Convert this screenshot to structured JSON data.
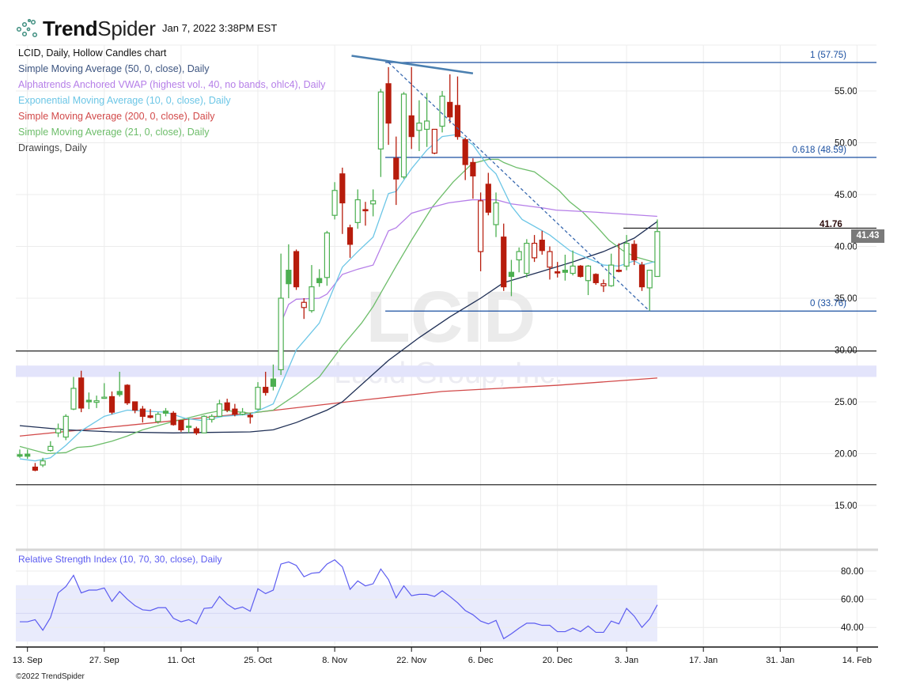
{
  "header": {
    "logo_text_bold": "Trend",
    "logo_text_light": "Spider",
    "timestamp": "Jan 7, 2022 3:38PM EST"
  },
  "legend": [
    {
      "label": "LCID, Daily, Hollow Candles chart",
      "color": "#111111"
    },
    {
      "label": "Simple Moving Average (50, 0, close), Daily",
      "color": "#3d5580"
    },
    {
      "label": "Alphatrends Anchored VWAP (highest vol., 40, no bands, ohlc4), Daily",
      "color": "#b57ee8"
    },
    {
      "label": "Exponential Moving Average (10, 0, close), Daily",
      "color": "#6cc6e6"
    },
    {
      "label": "Simple Moving Average (200, 0, close), Daily",
      "color": "#d24a4a"
    },
    {
      "label": "Simple Moving Average (21, 0, close), Daily",
      "color": "#6dbd6a"
    },
    {
      "label": "Drawings, Daily",
      "color": "#444444"
    }
  ],
  "watermark": {
    "symbol": "LCID",
    "company": "Lucid Group, Inc."
  },
  "footer": "©2022 TrendSpider",
  "chart_data": {
    "type": "candlestick",
    "symbol": "LCID",
    "interval": "Daily",
    "style": "Hollow Candles",
    "colors": {
      "up": "#4caf50",
      "down": "#b71c0c",
      "sma50": "#1f2f55",
      "vwap": "#b57ee8",
      "ema10": "#6cc6e6",
      "sma200": "#d24a4a",
      "sma21": "#6dbd6a",
      "rsi": "#5c5cf0"
    },
    "price_axis": {
      "range": [
        13,
        60
      ],
      "ticks": [
        "55.00",
        "50.00",
        "45.00",
        "40.00",
        "35.00",
        "30.00",
        "25.00",
        "20.00",
        "15.00"
      ],
      "tick_values": [
        55,
        50,
        45,
        40,
        35,
        30,
        25,
        20,
        15
      ]
    },
    "x_ticks": [
      {
        "label": "13. Sep",
        "index": 1
      },
      {
        "label": "27. Sep",
        "index": 11
      },
      {
        "label": "11. Oct",
        "index": 21
      },
      {
        "label": "25. Oct",
        "index": 31
      },
      {
        "label": "8. Nov",
        "index": 41
      },
      {
        "label": "22. Nov",
        "index": 51
      },
      {
        "label": "6. Dec",
        "index": 60
      },
      {
        "label": "20. Dec",
        "index": 70
      },
      {
        "label": "3. Jan",
        "index": 79
      },
      {
        "label": "17. Jan",
        "index": 89
      },
      {
        "label": "31. Jan",
        "index": 99
      },
      {
        "label": "14. Feb",
        "index": 109
      }
    ],
    "candles": [
      [
        19.9,
        20.4,
        19.6,
        19.75,
        "g"
      ],
      [
        19.95,
        20.4,
        19.5,
        19.75,
        "g"
      ],
      [
        18.7,
        19.1,
        18.3,
        18.4,
        "r"
      ],
      [
        18.9,
        19.6,
        18.7,
        19.3,
        "g"
      ],
      [
        20.3,
        21.2,
        20.2,
        20.7,
        "g"
      ],
      [
        22.0,
        22.9,
        21.6,
        22.4,
        "g"
      ],
      [
        21.6,
        23.8,
        21.3,
        23.6,
        "g"
      ],
      [
        24.3,
        27.4,
        24.2,
        26.3,
        "g"
      ],
      [
        27.3,
        28.0,
        24.0,
        24.4,
        "r"
      ],
      [
        25.15,
        25.9,
        24.3,
        25.0,
        "g"
      ],
      [
        24.95,
        25.6,
        24.4,
        25.1,
        "g"
      ],
      [
        25.4,
        26.8,
        25.3,
        25.45,
        "g"
      ],
      [
        25.5,
        26.0,
        23.8,
        24.0,
        "r"
      ],
      [
        26.0,
        27.9,
        25.5,
        25.7,
        "g"
      ],
      [
        26.6,
        26.7,
        24.7,
        24.9,
        "r"
      ],
      [
        25.0,
        25.0,
        23.9,
        24.2,
        "r"
      ],
      [
        24.3,
        24.6,
        23.0,
        23.6,
        "r"
      ],
      [
        23.65,
        24.3,
        23.4,
        23.5,
        "r"
      ],
      [
        23.1,
        24.0,
        22.9,
        23.8,
        "g"
      ],
      [
        24.1,
        24.4,
        23.6,
        23.9,
        "g"
      ],
      [
        23.9,
        24.1,
        22.7,
        22.8,
        "r"
      ],
      [
        23.2,
        23.2,
        22.1,
        22.3,
        "r"
      ],
      [
        22.65,
        23.4,
        22.0,
        22.55,
        "g"
      ],
      [
        22.4,
        22.6,
        21.8,
        22.0,
        "r"
      ],
      [
        22.0,
        23.7,
        22.0,
        23.6,
        "g"
      ],
      [
        23.3,
        23.8,
        23.0,
        23.6,
        "g"
      ],
      [
        23.6,
        25.2,
        23.6,
        24.8,
        "g"
      ],
      [
        24.9,
        25.3,
        24.0,
        24.2,
        "r"
      ],
      [
        24.3,
        24.8,
        23.6,
        23.8,
        "r"
      ],
      [
        23.8,
        24.4,
        23.7,
        24.0,
        "g"
      ],
      [
        23.7,
        23.9,
        22.9,
        23.55,
        "r"
      ],
      [
        24.3,
        26.9,
        24.2,
        26.4,
        "g"
      ],
      [
        26.4,
        27.9,
        25.6,
        25.9,
        "r"
      ],
      [
        27.2,
        28.6,
        26.1,
        26.5,
        "g"
      ],
      [
        28.1,
        39.3,
        27.6,
        35.0,
        "g"
      ],
      [
        37.7,
        40.2,
        35.0,
        36.4,
        "g"
      ],
      [
        39.5,
        39.7,
        35.8,
        36.1,
        "r"
      ],
      [
        34.1,
        35.0,
        33.0,
        34.6,
        "r"
      ],
      [
        33.8,
        38.2,
        33.6,
        36.1,
        "g"
      ],
      [
        36.9,
        37.8,
        36.1,
        36.5,
        "g"
      ],
      [
        37.0,
        41.5,
        36.2,
        41.3,
        "g"
      ],
      [
        43.0,
        46.2,
        42.6,
        45.4,
        "g"
      ],
      [
        47.0,
        47.6,
        41.2,
        44.2,
        "r"
      ],
      [
        41.8,
        42.1,
        38.9,
        40.2,
        "r"
      ],
      [
        42.3,
        45.5,
        41.7,
        44.5,
        "g"
      ],
      [
        43.55,
        44.3,
        42.0,
        43.45,
        "r"
      ],
      [
        44.1,
        45.5,
        42.9,
        44.4,
        "g"
      ],
      [
        49.4,
        55.2,
        46.7,
        54.9,
        "g"
      ],
      [
        55.7,
        57.3,
        49.8,
        51.9,
        "r"
      ],
      [
        48.5,
        50.6,
        44.0,
        46.5,
        "r"
      ],
      [
        46.7,
        54.9,
        46.5,
        54.7,
        "g"
      ],
      [
        52.6,
        57.3,
        49.4,
        50.6,
        "r"
      ],
      [
        51.2,
        54.1,
        49.2,
        51.9,
        "g"
      ],
      [
        51.3,
        54.8,
        49.6,
        52.1,
        "g"
      ],
      [
        49.0,
        51.3,
        48.9,
        51.3,
        "r"
      ],
      [
        51.6,
        55.0,
        51.0,
        54.5,
        "g"
      ],
      [
        53.9,
        56.6,
        51.9,
        52.5,
        "r"
      ],
      [
        53.6,
        56.4,
        50.3,
        50.6,
        "r"
      ],
      [
        50.3,
        50.5,
        46.4,
        47.9,
        "r"
      ],
      [
        48.1,
        48.5,
        44.6,
        46.8,
        "r"
      ],
      [
        39.5,
        45.2,
        37.6,
        44.4,
        "r"
      ],
      [
        46.0,
        47.1,
        43.0,
        43.3,
        "r"
      ],
      [
        42.1,
        45.2,
        40.9,
        44.2,
        "g"
      ],
      [
        40.9,
        42.2,
        35.7,
        36.1,
        "r"
      ],
      [
        37.5,
        38.7,
        35.2,
        37.1,
        "g"
      ],
      [
        38.7,
        39.9,
        37.5,
        39.5,
        "g"
      ],
      [
        37.4,
        40.7,
        37.0,
        40.3,
        "g"
      ],
      [
        38.9,
        41.1,
        38.5,
        40.3,
        "r"
      ],
      [
        40.6,
        41.5,
        39.2,
        39.6,
        "r"
      ],
      [
        38.0,
        40.0,
        36.8,
        39.5,
        "r"
      ],
      [
        37.55,
        38.5,
        37.0,
        37.45,
        "r"
      ],
      [
        37.7,
        39.2,
        36.7,
        37.5,
        "g"
      ],
      [
        37.4,
        39.6,
        37.2,
        38.1,
        "g"
      ],
      [
        38.1,
        38.2,
        37.0,
        37.1,
        "r"
      ],
      [
        36.7,
        38.2,
        35.3,
        38.1,
        "g"
      ],
      [
        37.3,
        37.4,
        36.3,
        36.5,
        "r"
      ],
      [
        36.2,
        36.8,
        35.6,
        36.4,
        "r"
      ],
      [
        36.2,
        39.3,
        36.1,
        38.2,
        "g"
      ],
      [
        37.7,
        40.3,
        37.5,
        37.6,
        "r"
      ],
      [
        38.1,
        41.1,
        37.7,
        40.3,
        "g"
      ],
      [
        40.2,
        40.6,
        38.2,
        38.7,
        "r"
      ],
      [
        38.2,
        38.5,
        35.7,
        36.1,
        "r"
      ],
      [
        36.0,
        37.7,
        33.76,
        37.7,
        "g"
      ],
      [
        37.1,
        42.6,
        37.1,
        41.43,
        "g"
      ]
    ],
    "overlays": {
      "sma50": [
        [
          0,
          22.7
        ],
        [
          6,
          22.3
        ],
        [
          12,
          22.1
        ],
        [
          20,
          22.0
        ],
        [
          30,
          22.1
        ],
        [
          33,
          22.3
        ],
        [
          36,
          23.0
        ],
        [
          40,
          24.2
        ],
        [
          42,
          25.0
        ],
        [
          48,
          29.0
        ],
        [
          52,
          31.2
        ],
        [
          56,
          33.2
        ],
        [
          60,
          35.0
        ],
        [
          63,
          36.5
        ],
        [
          68,
          37.6
        ],
        [
          72,
          38.5
        ],
        [
          76,
          39.5
        ],
        [
          80,
          40.8
        ],
        [
          83,
          42.4
        ]
      ],
      "sma200": [
        [
          0,
          21.7
        ],
        [
          15,
          22.8
        ],
        [
          31,
          24.0
        ],
        [
          45,
          25.2
        ],
        [
          55,
          26.0
        ],
        [
          60,
          26.2
        ],
        [
          70,
          26.6
        ],
        [
          83,
          27.3
        ]
      ],
      "ema10": [
        [
          0,
          19.5
        ],
        [
          2,
          19.3
        ],
        [
          4,
          19.6
        ],
        [
          6,
          20.8
        ],
        [
          8,
          22.2
        ],
        [
          11,
          23.6
        ],
        [
          14,
          24.2
        ],
        [
          19,
          24.0
        ],
        [
          21.6,
          23.4
        ],
        [
          23.7,
          23.2
        ],
        [
          26.5,
          23.6
        ],
        [
          30,
          23.8
        ],
        [
          33,
          24.8
        ],
        [
          36,
          30
        ],
        [
          39,
          32.6
        ],
        [
          42,
          38.0
        ],
        [
          44,
          39.5
        ],
        [
          46,
          40.9
        ],
        [
          48,
          45.1
        ],
        [
          49,
          45.3
        ],
        [
          51,
          47.5
        ],
        [
          53,
          49.3
        ],
        [
          55,
          50.6
        ],
        [
          57,
          50.8
        ],
        [
          59,
          49.8
        ],
        [
          61,
          47.7
        ],
        [
          62,
          47
        ],
        [
          64,
          43.9
        ],
        [
          65.4,
          42.6
        ],
        [
          69,
          41.1
        ],
        [
          71.6,
          39.6
        ],
        [
          76,
          38.2
        ],
        [
          78,
          38.1
        ],
        [
          80,
          38.6
        ],
        [
          81,
          38.2
        ],
        [
          83,
          38.6
        ]
      ],
      "sma21": [
        [
          0,
          20.7
        ],
        [
          3.5,
          20.0
        ],
        [
          6,
          20.1
        ],
        [
          7.5,
          20.6
        ],
        [
          9.3,
          20.7
        ],
        [
          12,
          21.2
        ],
        [
          14,
          21.7
        ],
        [
          16,
          22.3
        ],
        [
          20,
          23.1
        ],
        [
          24.4,
          23.9
        ],
        [
          26.5,
          24.2
        ],
        [
          30,
          23.9
        ],
        [
          33,
          24.2
        ],
        [
          36,
          25.7
        ],
        [
          39,
          27.4
        ],
        [
          42,
          30.4
        ],
        [
          44.5,
          32.6
        ],
        [
          46,
          34.2
        ],
        [
          49,
          38.1
        ],
        [
          51,
          40.6
        ],
        [
          53.7,
          43.8
        ],
        [
          56.4,
          46.2
        ],
        [
          58.9,
          48.0
        ],
        [
          61,
          48.4
        ],
        [
          62.3,
          48.4
        ],
        [
          63,
          48.1
        ],
        [
          64.7,
          47.6
        ],
        [
          67,
          47.2
        ],
        [
          68.8,
          46.2
        ],
        [
          70.2,
          45.4
        ],
        [
          71.6,
          44.3
        ],
        [
          73.3,
          43.3
        ],
        [
          75,
          42.0
        ],
        [
          76.7,
          40.6
        ],
        [
          78.5,
          39.6
        ],
        [
          80.1,
          39.0
        ],
        [
          83,
          38.4
        ]
      ],
      "vwap": [
        [
          34,
          32.6
        ],
        [
          35,
          34.4
        ],
        [
          36,
          34.9
        ],
        [
          39,
          35.0
        ],
        [
          40,
          35.4
        ],
        [
          42,
          37.3
        ],
        [
          44,
          37.8
        ],
        [
          46,
          38.2
        ],
        [
          48,
          41.5
        ],
        [
          49,
          41.8
        ],
        [
          51,
          43.2
        ],
        [
          53.3,
          43.7
        ],
        [
          55.8,
          44.2
        ],
        [
          58.9,
          44.5
        ],
        [
          62,
          44.5
        ],
        [
          64,
          44.1
        ],
        [
          68.2,
          43.7
        ],
        [
          69.8,
          43.5
        ],
        [
          75,
          43.3
        ],
        [
          83,
          42.9
        ]
      ]
    },
    "horizontal_levels": [
      {
        "label": "1 (57.75)",
        "value": 57.75,
        "type": "fib",
        "from_index": 48
      },
      {
        "label": "0.618 (48.59)",
        "value": 48.59,
        "type": "fib",
        "from_index": 48
      },
      {
        "label": "0 (33.76)",
        "value": 33.76,
        "type": "fib",
        "from_index": 48
      },
      {
        "label": "41.76",
        "value": 41.76,
        "type": "level",
        "from_index": 79
      },
      {
        "value": 29.9,
        "type": "support",
        "from_index": -1
      },
      {
        "value": 17.0,
        "type": "support",
        "from_index": -1
      }
    ],
    "zone": {
      "from": 27.4,
      "to": 28.5
    },
    "trendlines": [
      {
        "type": "solid",
        "from": [
          43.2,
          58.4
        ],
        "to": [
          59,
          56.7
        ]
      },
      {
        "type": "dashed",
        "from": [
          48,
          57.75
        ],
        "to": [
          82,
          33.76
        ]
      }
    ],
    "last_price": "41.43",
    "rsi": {
      "title": "Relative Strength Index (10, 70, 30, close), Daily",
      "ticks": [
        "80.00",
        "60.00",
        "40.00"
      ],
      "tick_values": [
        80,
        60,
        40
      ],
      "band": [
        30,
        70
      ],
      "mid": 50,
      "values": [
        44,
        44,
        45.5,
        38,
        47,
        64.5,
        69,
        77,
        64.5,
        66.5,
        66.5,
        68,
        58.5,
        65.5,
        60,
        55.5,
        52.5,
        52,
        54,
        54,
        46.5,
        44,
        45.5,
        42.5,
        53.5,
        54,
        62,
        56.5,
        53,
        54.5,
        51.5,
        67.5,
        64,
        66.5,
        85,
        86.5,
        84,
        76,
        78.5,
        79,
        85,
        88,
        83,
        67,
        73,
        69.5,
        71,
        81.5,
        74,
        61,
        69.5,
        62.5,
        63.5,
        63.5,
        62,
        66,
        62,
        57.5,
        52,
        49,
        44.5,
        42.5,
        45,
        32,
        35.5,
        39.5,
        43,
        43,
        41.5,
        41.5,
        37,
        37,
        39.5,
        37,
        41,
        36.5,
        36.5,
        44.5,
        42.5,
        53.5,
        48,
        40,
        46,
        56
      ]
    }
  }
}
